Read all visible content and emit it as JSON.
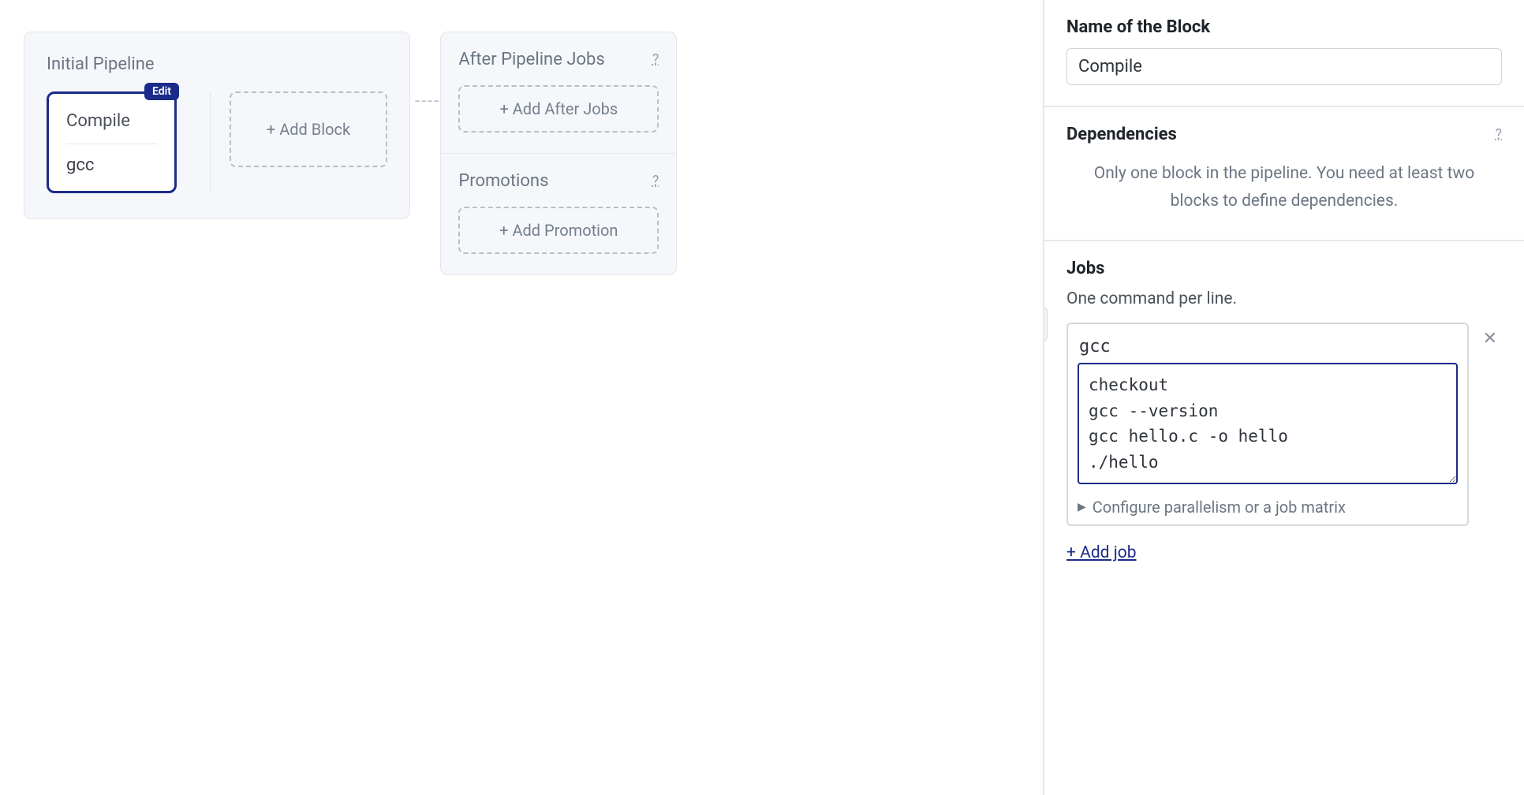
{
  "pipeline": {
    "title": "Initial Pipeline",
    "block": {
      "name": "Compile",
      "job": "gcc",
      "edit_badge": "Edit"
    },
    "add_block_label": "+ Add Block"
  },
  "connector": "----",
  "after_jobs": {
    "title": "After Pipeline Jobs",
    "help": "?",
    "add_label": "+ Add After Jobs"
  },
  "promotions": {
    "title": "Promotions",
    "help": "?",
    "add_label": "+ Add Promotion"
  },
  "inspector": {
    "name_section": {
      "label": "Name of the Block",
      "value": "Compile"
    },
    "dependencies": {
      "label": "Dependencies",
      "help": "?",
      "message": "Only one block in the pipeline. You need at least two blocks to define dependencies."
    },
    "jobs": {
      "label": "Jobs",
      "subtitle": "One command per line.",
      "job_name": "gcc",
      "commands": "checkout\ngcc --version\ngcc hello.c -o hello\n./hello",
      "remove_icon": "✕",
      "parallelism_label": "Configure parallelism or a job matrix",
      "add_job_label": "+ Add job"
    }
  }
}
